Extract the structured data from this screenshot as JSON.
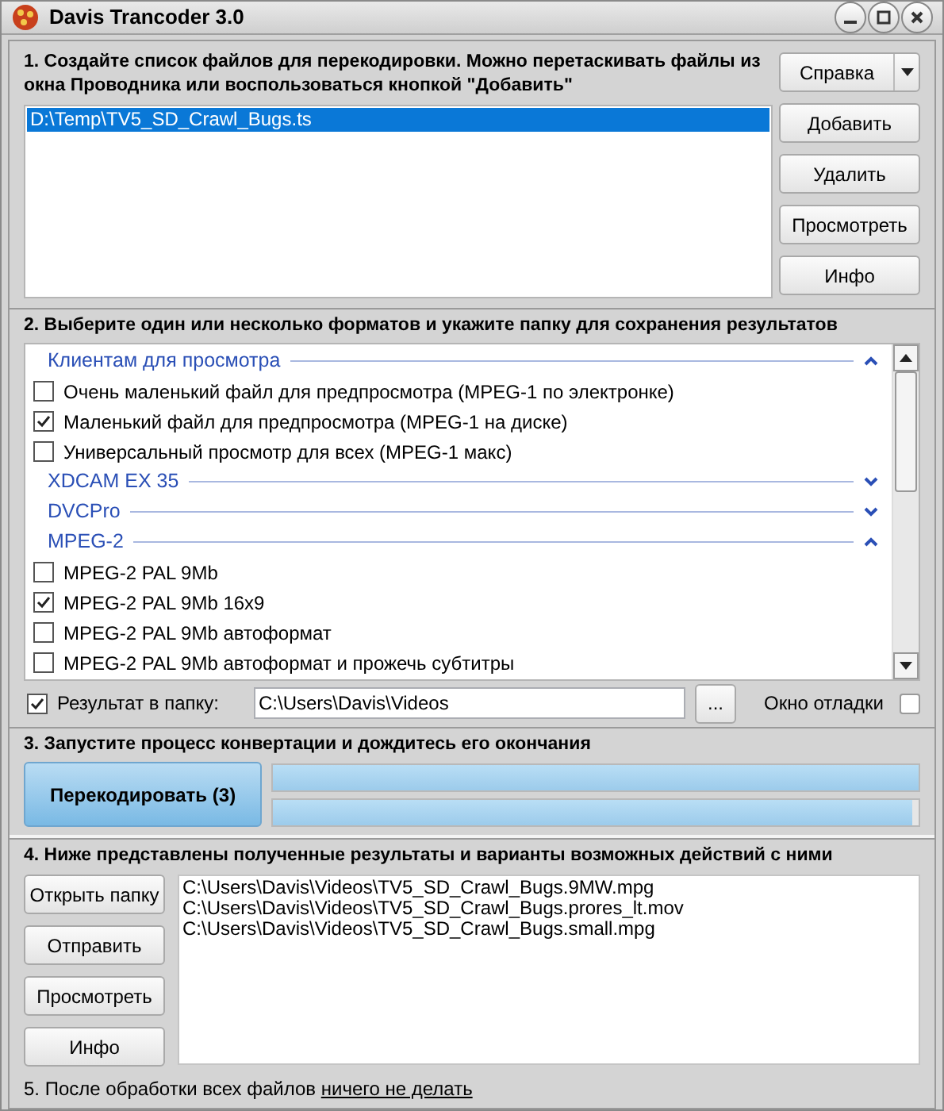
{
  "window": {
    "title": "Davis Trancoder 3.0"
  },
  "step1": {
    "heading": "1. Создайте список файлов для перекодировки. Можно перетаскивать файлы из окна Проводника или воспользоваться кнопкой \"Добавить\"",
    "files": [
      {
        "label": "D:\\Temp\\TV5_SD_Crawl_Bugs.ts",
        "selected": true
      }
    ],
    "help_button": "Справка",
    "buttons": [
      "Добавить",
      "Удалить",
      "Просмотреть",
      "Инфо"
    ]
  },
  "step2": {
    "heading": "2. Выберите один или несколько форматов и укажите папку для сохранения результатов",
    "format_groups": [
      {
        "label": "Клиентам для просмотра",
        "expanded": true,
        "options": [
          {
            "label": "Очень маленький файл для предпросмотра (MPEG-1 по электронке)",
            "checked": false
          },
          {
            "label": "Маленький файл для предпросмотра (MPEG-1 на диске)",
            "checked": true
          },
          {
            "label": "Универсальный просмотр для всех (MPEG-1 макс)",
            "checked": false
          }
        ]
      },
      {
        "label": "XDCAM EX 35",
        "expanded": false
      },
      {
        "label": "DVCPro",
        "expanded": false
      },
      {
        "label": "MPEG-2",
        "expanded": true,
        "options": [
          {
            "label": "MPEG-2 PAL 9Mb",
            "checked": false
          },
          {
            "label": "MPEG-2 PAL 9Mb 16x9",
            "checked": true
          },
          {
            "label": "MPEG-2 PAL 9Mb автоформат",
            "checked": false
          },
          {
            "label": "MPEG-2 PAL 9Mb автоформат и прожечь субтитры",
            "checked": false
          }
        ]
      }
    ],
    "output_folder": {
      "label": "Результат в папку:",
      "checked": true,
      "value": "C:\\Users\\Davis\\Videos",
      "browse_button": "..."
    },
    "debug_window": {
      "label": "Окно отладки",
      "checked": false
    }
  },
  "step3": {
    "heading": "3. Запустите процесс конвертации и дождитесь его окончания",
    "convert_button": "Перекодировать (3)",
    "progress": [
      {
        "level": 1
      },
      {
        "level": 0.99
      }
    ]
  },
  "step4": {
    "heading": "4. Ниже представлены полученные результаты и варианты возможных действий с ними",
    "buttons": [
      "Открыть папку",
      "Отправить",
      "Просмотреть",
      "Инфо"
    ],
    "results": [
      "C:\\Users\\Davis\\Videos\\TV5_SD_Crawl_Bugs.9MW.mpg",
      "C:\\Users\\Davis\\Videos\\TV5_SD_Crawl_Bugs.prores_lt.mov",
      "C:\\Users\\Davis\\Videos\\TV5_SD_Crawl_Bugs.small.mpg"
    ]
  },
  "step5": {
    "text": "5. После обработки всех файлов ",
    "link": "ничего не делать"
  }
}
